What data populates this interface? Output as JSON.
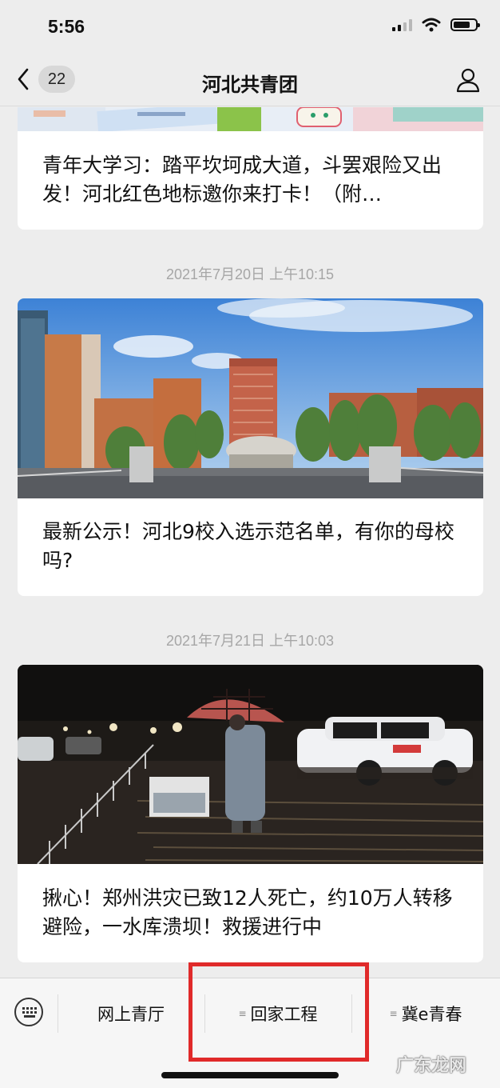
{
  "status_bar": {
    "time": "5:56"
  },
  "nav": {
    "back_count": "22",
    "title": "河北共青团"
  },
  "articles": [
    {
      "title": "青年大学习：踏平坎坷成大道，斗罢艰险又出发！河北红色地标邀你来打卡！（附…"
    },
    {
      "timestamp": "2021年7月20日 上午10:15",
      "title": "最新公示！河北9校入选示范名单，有你的母校吗?"
    },
    {
      "timestamp": "2021年7月21日 上午10:03",
      "title": "揪心！郑州洪灾已致12人死亡，约10万人转移避险，一水库溃坝！救援进行中"
    }
  ],
  "menu": {
    "items": [
      {
        "label": "网上青厅"
      },
      {
        "label": "回家工程",
        "dots": "≡"
      },
      {
        "label": "冀e青春",
        "dots": "≡"
      }
    ]
  },
  "watermark": "广东龙网",
  "colors": {
    "highlight": "#e02a2a",
    "background": "#ededed",
    "card": "#ffffff",
    "timestamp": "#a6a6a6"
  }
}
